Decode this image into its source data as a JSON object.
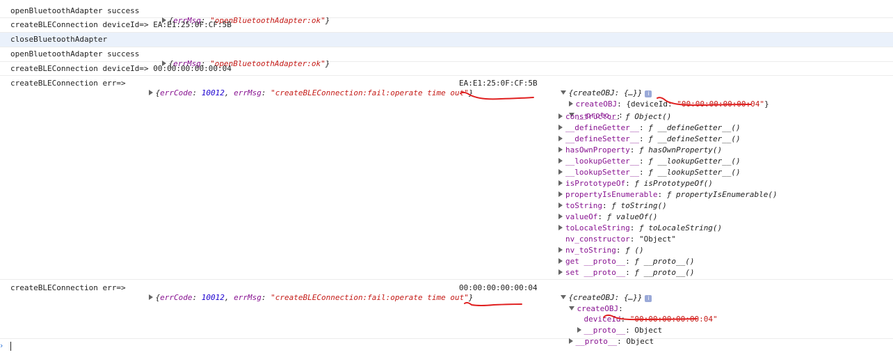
{
  "console": {
    "line1": {
      "message": "openBluetoothAdapter success",
      "obj_key": "errMsg",
      "obj_val": "\"openBluetoothAdapter:ok\""
    },
    "line2": {
      "message": "createBLEConnection deviceId=> EA:E1:25:0F:CF:5B"
    },
    "line3": {
      "message": "closeBluetoothAdapter"
    },
    "line4": {
      "message": "openBluetoothAdapter success",
      "obj_key": "errMsg",
      "obj_val": "\"openBluetoothAdapter:ok\""
    },
    "line5": {
      "message": "createBLEConnection deviceId=> 00:00:00:00:00:04"
    },
    "err1": {
      "message": "createBLEConnection err=>",
      "err_code_key": "errCode",
      "err_code_val": "10012",
      "err_msg_key": "errMsg",
      "err_msg_val": "\"createBLEConnection:fail:operate time out\"",
      "device": "EA:E1:25:0F:CF:5B",
      "summary": "{createOBJ: {…}}",
      "info_badge": "i",
      "createobj_key": "createOBJ",
      "createobj_val_prefix": "{deviceId: ",
      "createobj_val_str": "\"00:00:00:00:00:04\"",
      "createobj_val_suffix": "}",
      "proto_key": "__proto__",
      "proto_items": [
        {
          "key": "constructor",
          "val": "Object()"
        },
        {
          "key": "__defineGetter__",
          "val": "__defineGetter__()"
        },
        {
          "key": "__defineSetter__",
          "val": "__defineSetter__()"
        },
        {
          "key": "hasOwnProperty",
          "val": "hasOwnProperty()"
        },
        {
          "key": "__lookupGetter__",
          "val": "__lookupGetter__()"
        },
        {
          "key": "__lookupSetter__",
          "val": "__lookupSetter__()"
        },
        {
          "key": "isPrototypeOf",
          "val": "isPrototypeOf()"
        },
        {
          "key": "propertyIsEnumerable",
          "val": "propertyIsEnumerable()"
        },
        {
          "key": "toString",
          "val": "toString()"
        },
        {
          "key": "valueOf",
          "val": "valueOf()"
        },
        {
          "key": "toLocaleString",
          "val": "toLocaleString()"
        },
        {
          "key": "nv_constructor",
          "val": "\"Object\"",
          "plain": true
        },
        {
          "key": "nv_toString",
          "val": "()"
        },
        {
          "key": "get __proto__",
          "val": "__proto__()"
        },
        {
          "key": "set __proto__",
          "val": "__proto__()"
        }
      ],
      "func_glyph": "ƒ"
    },
    "err2": {
      "message": "createBLEConnection err=>",
      "err_code_key": "errCode",
      "err_code_val": "10012",
      "err_msg_key": "errMsg",
      "err_msg_val": "\"createBLEConnection:fail:operate time out\"",
      "device": "00:00:00:00:00:04",
      "summary": "{createOBJ: {…}}",
      "info_badge": "i",
      "createobj_key": "createOBJ",
      "deviceid_key": "deviceId",
      "deviceid_val": "\"00:00:00:00:00:04\"",
      "inner_proto_key": "__proto__",
      "inner_proto_val": "Object",
      "outer_proto_key": "__proto__",
      "outer_proto_val": "Object"
    },
    "prompt_symbol": "›"
  }
}
